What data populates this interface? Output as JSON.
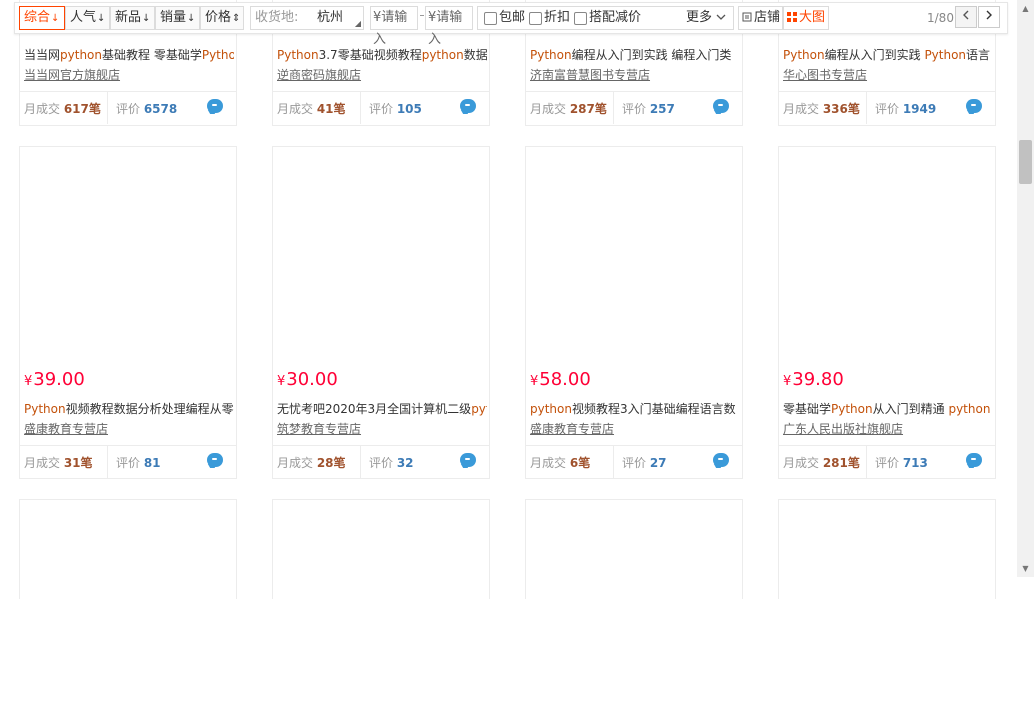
{
  "filterbar": {
    "sorts": [
      {
        "label": "综合",
        "arrow": "↓"
      },
      {
        "label": "人气",
        "arrow": "↓"
      },
      {
        "label": "新品",
        "arrow": "↓"
      },
      {
        "label": "销量",
        "arrow": "↓"
      },
      {
        "label": "价格",
        "arrow": "⇕"
      }
    ],
    "location": {
      "label": "收货地:",
      "city": "杭州"
    },
    "price_min": {
      "placeholder": "¥请输入"
    },
    "price_max": {
      "placeholder": "¥请输入"
    },
    "options": [
      {
        "label": "包邮"
      },
      {
        "label": "折扣"
      },
      {
        "label": "搭配减价"
      }
    ],
    "more_label": "更多",
    "view_shop_label": "店铺",
    "view_grid_label": "大图",
    "page_indicator": "1/80",
    "prev_icon": "chevron-left-icon",
    "next_icon": "chevron-right-icon"
  },
  "colors": {
    "accent": "#ff4400",
    "price": "#ff0036",
    "keyword": "#c3510a",
    "rating": "#3d7bb6",
    "wangwang": "#3a9ad9"
  },
  "common": {
    "deal_prefix": "月成交 ",
    "deal_suffix": "笔",
    "rating_prefix": "评价 "
  },
  "products": [
    {
      "price_symbol": "¥",
      "price": "",
      "title": [
        {
          "t": "当当网",
          "hl": false
        },
        {
          "t": "python",
          "hl": true
        },
        {
          "t": "基础教程 零基础学",
          "hl": false
        },
        {
          "t": "Pytho",
          "hl": true
        }
      ],
      "shop": "当当网官方旗舰店",
      "monthly_sales": "617",
      "reviews": "6578"
    },
    {
      "price_symbol": "¥",
      "price": "",
      "title": [
        {
          "t": "Python",
          "hl": true
        },
        {
          "t": "3.7零基础视频教程",
          "hl": false
        },
        {
          "t": "python",
          "hl": true
        },
        {
          "t": "数据",
          "hl": false
        }
      ],
      "shop": "逆商密码旗舰店",
      "monthly_sales": "41",
      "reviews": "105"
    },
    {
      "price_symbol": "¥",
      "price": "",
      "title": [
        {
          "t": "Python",
          "hl": true
        },
        {
          "t": "编程从入门到实践 编程入门类",
          "hl": false
        }
      ],
      "shop": "济南富普慧图书专营店",
      "monthly_sales": "287",
      "reviews": "257"
    },
    {
      "price_symbol": "¥",
      "price": "",
      "title": [
        {
          "t": "Python",
          "hl": true
        },
        {
          "t": "编程从入门到实践 ",
          "hl": false
        },
        {
          "t": "Python",
          "hl": true
        },
        {
          "t": "语言",
          "hl": false
        }
      ],
      "shop": "华心图书专营店",
      "monthly_sales": "336",
      "reviews": "1949"
    },
    {
      "price_symbol": "¥",
      "price": "39.00",
      "title": [
        {
          "t": "Python",
          "hl": true
        },
        {
          "t": "视频教程数据分析处理编程从零",
          "hl": false
        }
      ],
      "shop": "盛康教育专营店",
      "monthly_sales": "31",
      "reviews": "81"
    },
    {
      "price_symbol": "¥",
      "price": "30.00",
      "title": [
        {
          "t": "无忧考吧2020年3月全国计算机二级",
          "hl": false
        },
        {
          "t": "pyt",
          "hl": true
        }
      ],
      "shop": "筑梦教育专营店",
      "monthly_sales": "28",
      "reviews": "32"
    },
    {
      "price_symbol": "¥",
      "price": "58.00",
      "title": [
        {
          "t": "python",
          "hl": true
        },
        {
          "t": "视频教程3入门基础编程语言数",
          "hl": false
        }
      ],
      "shop": "盛康教育专营店",
      "monthly_sales": "6",
      "reviews": "27"
    },
    {
      "price_symbol": "¥",
      "price": "39.80",
      "title": [
        {
          "t": "零基础学",
          "hl": false
        },
        {
          "t": "Python",
          "hl": true
        },
        {
          "t": "从入门到精通 ",
          "hl": false
        },
        {
          "t": "python",
          "hl": true
        }
      ],
      "shop": "广东人民出版社旗舰店",
      "monthly_sales": "281",
      "reviews": "713"
    }
  ]
}
